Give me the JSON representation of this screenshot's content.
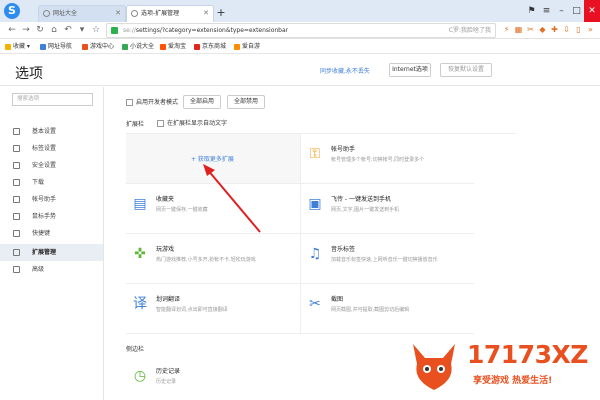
{
  "browser": {
    "logo_letter": "S",
    "tabs": [
      {
        "label": "网址大全",
        "active": false
      },
      {
        "label": "选项-扩展管理",
        "active": true
      }
    ],
    "new_tab": "+",
    "address": {
      "protocol": "se://",
      "path": "settings/?category=extension&type=extensionbar",
      "suggest": "C罗:我脸啥了我"
    },
    "bookmarks": [
      {
        "label": "收藏",
        "color": "#f2b400"
      },
      {
        "label": "网址导航",
        "color": "#3e7fd8"
      },
      {
        "label": "游戏中心",
        "color": "#e8501f"
      },
      {
        "label": "小说大全",
        "color": "#34a853"
      },
      {
        "label": "爱淘宝",
        "color": "#ff5000"
      },
      {
        "label": "京东商城",
        "color": "#e1251b"
      },
      {
        "label": "爱自游",
        "color": "#ff8c00"
      }
    ]
  },
  "header": {
    "title": "选项",
    "sync_link": "同步收藏,永不丢失",
    "internet_button": "Internet选项",
    "restore_button": "恢复默认设置"
  },
  "sidebar": {
    "search_placeholder": "搜索选项",
    "items": [
      {
        "label": "基本设置",
        "active": false,
        "icon": "gear-icon"
      },
      {
        "label": "标签设置",
        "active": false,
        "icon": "tab-icon"
      },
      {
        "label": "安全设置",
        "active": false,
        "icon": "shield-icon"
      },
      {
        "label": "下载",
        "active": false,
        "icon": "download-icon"
      },
      {
        "label": "帐号助手",
        "active": false,
        "icon": "key-icon"
      },
      {
        "label": "鼠标手势",
        "active": false,
        "icon": "mouse-icon"
      },
      {
        "label": "快捷键",
        "active": false,
        "icon": "keyboard-icon"
      },
      {
        "label": "扩展管理",
        "active": true,
        "icon": "extension-icon"
      },
      {
        "label": "高级",
        "active": false,
        "icon": "advanced-icon"
      }
    ]
  },
  "main": {
    "dev_mode_label": "启用开发者模式",
    "enable_all": "全部启用",
    "disable_all": "全部禁用",
    "extbar_label": "扩展栏",
    "show_text_label": "在扩展栏显示自动文字",
    "get_more": "+ 获取更多扩展",
    "extensions": [
      {
        "name": "帐号助手",
        "desc": "帐号管理多个帐号,切换帐号,同时登录多个",
        "icon": "key-icon",
        "color": "#f0a020"
      },
      {
        "name": "收藏夹",
        "desc": "网页一键保存,一键收藏",
        "icon": "bookmark-icon",
        "color": "#3e7fd8"
      },
      {
        "name": "飞传 - 一键发送到手机",
        "desc": "网页,文字,图片一键发送到手机",
        "icon": "phone-send-icon",
        "color": "#3e7fd8"
      },
      {
        "name": "玩游戏",
        "desc": "热门游戏推荐,小号多开,抢帐不卡,轻松玩游戏",
        "icon": "gamepad-icon",
        "color": "#5ab834"
      },
      {
        "name": "音乐标签",
        "desc": "加载音乐标签快速,上网听音乐一键切换播放音乐",
        "icon": "music-icon",
        "color": "#3e7fd8"
      },
      {
        "name": "划词翻译",
        "desc": "智能翻译划词,点出即可直接翻译",
        "icon": "translate-icon",
        "color": "#3e7fd8"
      },
      {
        "name": "截图",
        "desc": "网页截图,并可提取,截图剪切后编辑",
        "icon": "scissors-icon",
        "color": "#3e7fd8"
      }
    ],
    "sidebar_bar_label": "侧边栏",
    "sidebar_ext": {
      "name": "历史记录",
      "desc": "历史记录",
      "icon": "history-icon",
      "color": "#5ab834"
    }
  },
  "watermark": {
    "number": "17173XZ",
    "slogan": "享受游戏 热爱生活!"
  }
}
